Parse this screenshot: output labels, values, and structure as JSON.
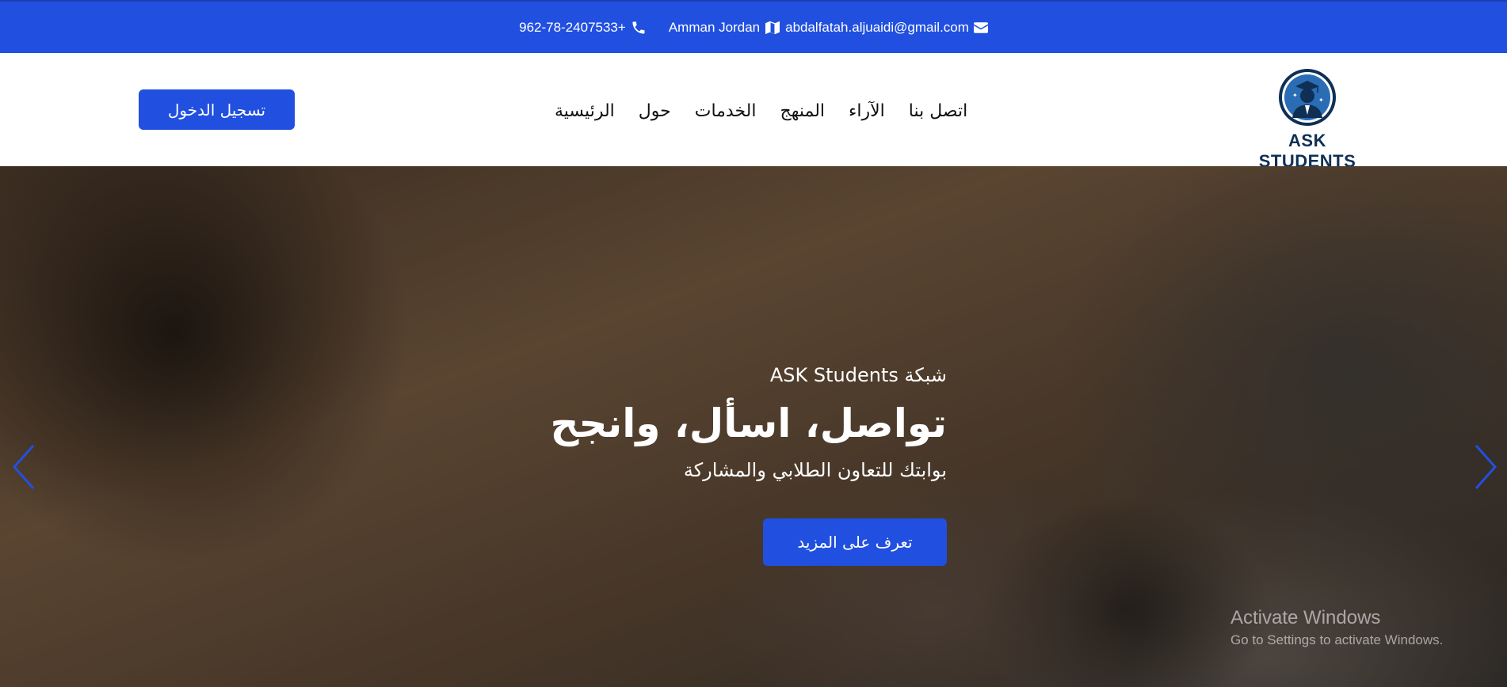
{
  "topbar": {
    "email": "abdalfatah.aljuaidi@gmail.com",
    "location": "Amman Jordan",
    "phone": "962-78-2407533+",
    "email_icon": "envelope-icon",
    "location_icon": "map-icon",
    "phone_icon": "phone-icon"
  },
  "header": {
    "logo_text": "ASK STUDENTS",
    "login_label": "تسجيل الدخول",
    "nav": [
      {
        "label": "الرئيسية"
      },
      {
        "label": "حول"
      },
      {
        "label": "الخدمات"
      },
      {
        "label": "المنهج"
      },
      {
        "label": "الآراء"
      },
      {
        "label": "اتصل بنا"
      }
    ]
  },
  "hero": {
    "kicker": "شبكة ASK Students",
    "title": "تواصل، اسأل، وانجح",
    "subtitle": "بوابتك للتعاون الطلابي والمشاركة",
    "cta_label": "تعرف على المزيد",
    "prev_icon": "chevron-left-icon",
    "next_icon": "chevron-right-icon"
  },
  "watermark": {
    "line1": "Activate Windows",
    "line2": "Go to Settings to activate Windows."
  },
  "colors": {
    "primary": "#2150e0",
    "logo_dark": "#0f2f55"
  }
}
